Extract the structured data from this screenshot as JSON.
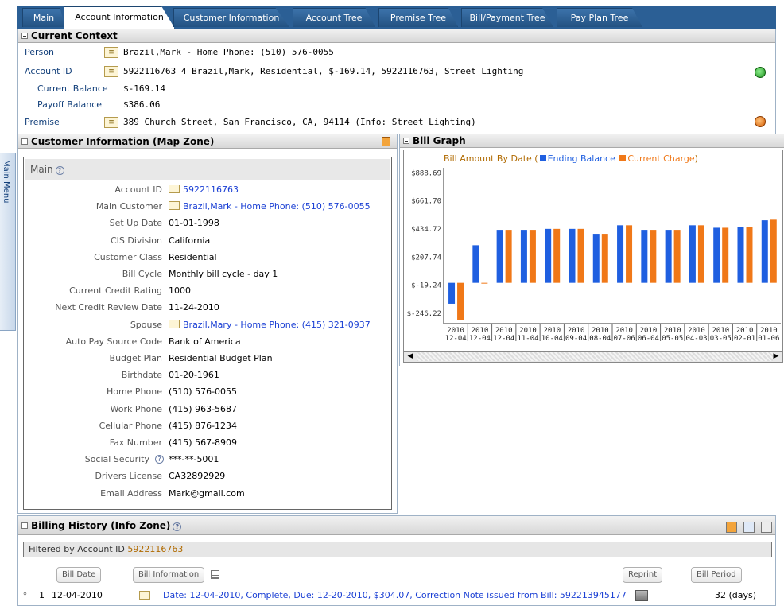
{
  "tabs": [
    {
      "label": "Main"
    },
    {
      "label": "Account Information"
    },
    {
      "label": "Customer Information"
    },
    {
      "label": "Account Tree"
    },
    {
      "label": "Premise Tree"
    },
    {
      "label": "Bill/Payment Tree"
    },
    {
      "label": "Pay Plan Tree"
    }
  ],
  "context": {
    "title": "Current Context",
    "person_label": "Person",
    "person_value": "Brazil,Mark - Home Phone: (510) 576-0055",
    "account_label": "Account ID",
    "account_value": "5922116763 4 Brazil,Mark, Residential, $-169.14, 5922116763, Street Lighting",
    "current_balance_label": "Current Balance",
    "current_balance_value": "$-169.14",
    "payoff_balance_label": "Payoff Balance",
    "payoff_balance_value": "$386.06",
    "premise_label": "Premise",
    "premise_value": "389 Church Street, San Francisco, CA, 94114 (Info: Street Lighting)"
  },
  "side_menu": {
    "label": "Main Menu"
  },
  "map_zone": {
    "title": "Customer Information (Map Zone)",
    "section": "Main",
    "fields": [
      {
        "label": "Account ID",
        "value": "5922116763"
      },
      {
        "label": "Main Customer",
        "value": "Brazil,Mark - Home Phone: (510) 576-0055"
      },
      {
        "label": "Set Up Date",
        "value": "01-01-1998"
      },
      {
        "label": "CIS Division",
        "value": "California"
      },
      {
        "label": "Customer Class",
        "value": "Residential"
      },
      {
        "label": "Bill Cycle",
        "value": "Monthly bill cycle - day 1"
      },
      {
        "label": "Current Credit Rating",
        "value": "1000"
      },
      {
        "label": "Next Credit Review Date",
        "value": "11-24-2010"
      },
      {
        "label": "Spouse",
        "value": "Brazil,Mary - Home Phone: (415) 321-0937"
      },
      {
        "label": "Auto Pay Source Code",
        "value": "Bank of America"
      },
      {
        "label": "Budget Plan",
        "value": "Residential Budget Plan"
      },
      {
        "label": "Birthdate",
        "value": "01-20-1961"
      },
      {
        "label": "Home Phone",
        "value": "(510) 576-0055"
      },
      {
        "label": "Work Phone",
        "value": "(415) 963-5687"
      },
      {
        "label": "Cellular Phone",
        "value": "(415) 876-1234"
      },
      {
        "label": "Fax Number",
        "value": "(415) 567-8909"
      },
      {
        "label": "Social Security",
        "value": "***-**-5001"
      },
      {
        "label": "Drivers License",
        "value": "CA32892929"
      },
      {
        "label": "Email Address",
        "value": "Mark@gmail.com"
      }
    ]
  },
  "bill_graph": {
    "title": "Bill Graph",
    "chart_title_prefix": "Bill Amount By Date (",
    "legend_ending": "Ending Balance",
    "legend_current": "Current Charge",
    "chart_title_suffix": ")",
    "colors": {
      "ending": "#1f5fe0",
      "current": "#f07818"
    }
  },
  "chart_data": {
    "type": "bar",
    "title": "Bill Amount By Date",
    "ytick_labels": [
      "$888.69",
      "$661.70",
      "$434.72",
      "$207.74",
      "$-19.24",
      "$-246.22"
    ],
    "ytick_values": [
      888.69,
      661.7,
      434.72,
      207.74,
      -19.24,
      -246.22
    ],
    "ylim": [
      -330,
      930
    ],
    "categories": [
      [
        "2010",
        "12-04"
      ],
      [
        "2010",
        "12-04"
      ],
      [
        "2010",
        "12-04"
      ],
      [
        "2010",
        "11-04"
      ],
      [
        "2010",
        "10-04"
      ],
      [
        "2010",
        "09-04"
      ],
      [
        "2010",
        "08-04"
      ],
      [
        "2010",
        "07-06"
      ],
      [
        "2010",
        "06-04"
      ],
      [
        "2010",
        "05-05"
      ],
      [
        "2010",
        "04-03"
      ],
      [
        "2010",
        "03-05"
      ],
      [
        "2010",
        "02-01"
      ],
      [
        "2010",
        "01-06"
      ]
    ],
    "series": [
      {
        "name": "Ending Balance",
        "values": [
          -169,
          304,
          428,
          428,
          436,
          436,
          396,
          465,
          428,
          428,
          465,
          445,
          448,
          505
        ]
      },
      {
        "name": "Current Charge",
        "values": [
          -300,
          0,
          428,
          428,
          436,
          436,
          396,
          465,
          428,
          428,
          465,
          445,
          448,
          510
        ]
      }
    ]
  },
  "billing": {
    "title": "Billing History (Info Zone)",
    "filter_prefix": "Filtered by Account ID ",
    "filter_account": "5922116763",
    "col_bill_date": "Bill Date",
    "col_bill_info": "Bill Information",
    "col_reprint": "Reprint",
    "col_bill_period": "Bill Period",
    "row": {
      "index": "1",
      "date": "12-04-2010",
      "info": "Date: 12-04-2010, Complete, Due: 12-20-2010, $304.07, Correction Note issued from Bill: 592213945177",
      "period": "32 (days)"
    }
  }
}
